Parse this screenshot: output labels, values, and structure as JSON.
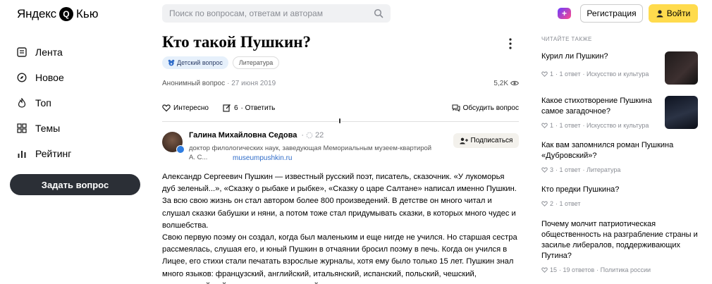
{
  "logo": {
    "brand": "Яндекс",
    "mark": "Q",
    "product": "Кью"
  },
  "nav": [
    {
      "label": "Лента",
      "icon": "feed-icon"
    },
    {
      "label": "Новое",
      "icon": "compass-icon"
    },
    {
      "label": "Топ",
      "icon": "fire-icon"
    },
    {
      "label": "Темы",
      "icon": "grid-icon"
    },
    {
      "label": "Рейтинг",
      "icon": "bars-icon"
    }
  ],
  "ask_button": "Задать вопрос",
  "search": {
    "placeholder": "Поиск по вопросам, ответам и авторам"
  },
  "header": {
    "plus_label": "+",
    "register": "Регистрация",
    "login": "Войти"
  },
  "question": {
    "title": "Кто такой Пушкин?",
    "tags": [
      "Детский вопрос",
      "Литература"
    ],
    "author": "Анонимный вопрос",
    "date": "· 27 июня 2019",
    "views": "5,2K",
    "actions": {
      "like": "Интересно",
      "answers_count": "6",
      "answer": "· Ответить",
      "discuss": "Обсудить вопрос"
    }
  },
  "answer": {
    "author_name": "Галина Михайловна Седова",
    "rating_prefix": "·",
    "rating": "22",
    "description": "доктор филологических наук, заведующая Мемориальным музеем-квартирой А. С...",
    "description_line1": "доктор филологических наук, заведующая Мемориальным музеем-квартирой",
    "description_line2": "А. С...",
    "link": "museumpushkin.ru",
    "follow": "Подписаться",
    "paragraphs": [
      "Александр Сергеевич Пушкин — известный русский поэт, писатель, сказочник. «У лукоморья дуб зеленый...», «Сказку о рыбаке и рыбке», «Сказку о царе Салтане» написал именно Пушкин. За всю свою жизнь он стал автором более 800 произведений. В детстве он много читал и слушал сказки бабушки и няни, а потом тоже стал придумывать сказки, в которых много чудес и волшебства.",
      "Свою первую поэму он создал, когда был маленьким и еще нигде не учился. Но старшая сестра рассмеялась, слушая его, и юный Пушкин в отчаянии бросил поэму в печь. Когда он учился в Лицее, его стихи стали печатать взрослые журналы, хотя ему было только 15 лет. Пушкин знал много языков: французский, английский, итальянский, испанский, польский, чешский, древнееврейский язык, и только немецкий ему не давался."
    ]
  },
  "sidebar": {
    "heading": "ЧИТАЙТЕ ТАКЖЕ",
    "items": [
      {
        "title": "Курил ли Пушкин?",
        "likes": "1",
        "answers": "· 1 ответ",
        "topic": "· Искусство и культура"
      },
      {
        "title": "Какое стихотворение Пушкина самое загадочное?",
        "likes": "1",
        "answers": "· 1 ответ",
        "topic": "· Искусство и культура"
      },
      {
        "title": "Как вам запомнился роман Пушкина «Дубровский»?",
        "likes": "3",
        "answers": "· 1 ответ",
        "topic": "· Литература"
      },
      {
        "title": "Кто предки Пушкина?",
        "likes": "2",
        "answers": "· 1 ответ",
        "topic": ""
      },
      {
        "title": "Почему молчит патриотическая общественность на разграбление страны и засилье либералов, поддерживающих Путина?",
        "likes": "15",
        "answers": "· 19 ответов",
        "topic": "· Политика россии"
      }
    ]
  }
}
